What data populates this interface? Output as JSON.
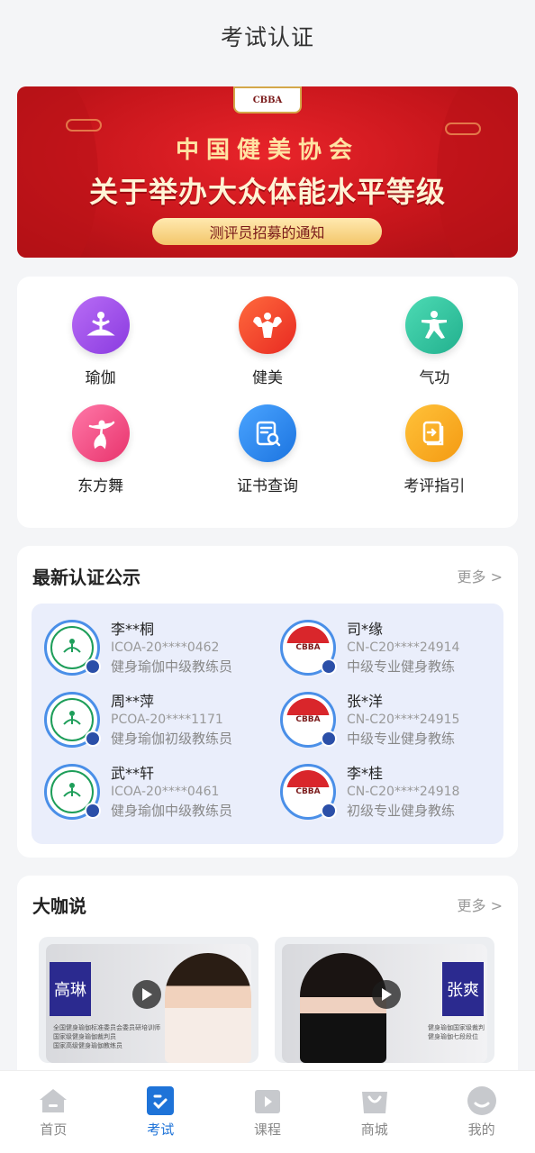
{
  "header": {
    "title": "考试认证"
  },
  "banner": {
    "logo_text": "CBBA",
    "line1": "中国健美协会",
    "line2": "关于举办大众体能水平等级",
    "subtitle": "测评员招募的通知"
  },
  "categories": [
    {
      "label": "瑜伽",
      "icon": "yoga-icon",
      "color": "#9b4de8"
    },
    {
      "label": "健美",
      "icon": "bodybuilding-icon",
      "color": "#f0412c"
    },
    {
      "label": "气功",
      "icon": "qigong-icon",
      "color": "#2ec4a0"
    },
    {
      "label": "东方舞",
      "icon": "dance-icon",
      "color": "#f0457e"
    },
    {
      "label": "证书查询",
      "icon": "certificate-search-icon",
      "color": "#2a8af0"
    },
    {
      "label": "考评指引",
      "icon": "guide-icon",
      "color": "#f7a21b"
    }
  ],
  "certifications": {
    "title": "最新认证公示",
    "more": "更多 >",
    "items": [
      {
        "name": "李**桐",
        "code": "ICOA-20****0462",
        "level": "健身瑜伽中级教练员",
        "org": "yoga"
      },
      {
        "name": "司*缘",
        "code": "CN-C20****24914",
        "level": "中级专业健身教练",
        "org": "cbba"
      },
      {
        "name": "周**萍",
        "code": "PCOA-20****1171",
        "level": "健身瑜伽初级教练员",
        "org": "yoga"
      },
      {
        "name": "张*洋",
        "code": "CN-C20****24915",
        "level": "中级专业健身教练",
        "org": "cbba"
      },
      {
        "name": "武**轩",
        "code": "ICOA-20****0461",
        "level": "健身瑜伽中级教练员",
        "org": "yoga"
      },
      {
        "name": "李*桂",
        "code": "CN-C20****24918",
        "level": "初级专业健身教练",
        "org": "cbba"
      }
    ]
  },
  "experts": {
    "title": "大咖说",
    "more": "更多 >",
    "videos": [
      {
        "tag": "高琳",
        "caption_lines": [
          "全国健身瑜伽标准委员会委员研培训师",
          "国家级健身瑜伽裁判员",
          "国家高级健身瑜伽教练员"
        ]
      },
      {
        "tag": "张爽",
        "caption_lines": [
          "健身瑜伽国家级裁判",
          "健身瑜伽七段段位"
        ]
      }
    ]
  },
  "tabbar": {
    "items": [
      {
        "label": "首页",
        "icon": "home-icon",
        "active": false
      },
      {
        "label": "考试",
        "icon": "exam-icon",
        "active": true
      },
      {
        "label": "课程",
        "icon": "course-icon",
        "active": false
      },
      {
        "label": "商城",
        "icon": "shop-icon",
        "active": false
      },
      {
        "label": "我的",
        "icon": "profile-icon",
        "active": false
      }
    ]
  }
}
